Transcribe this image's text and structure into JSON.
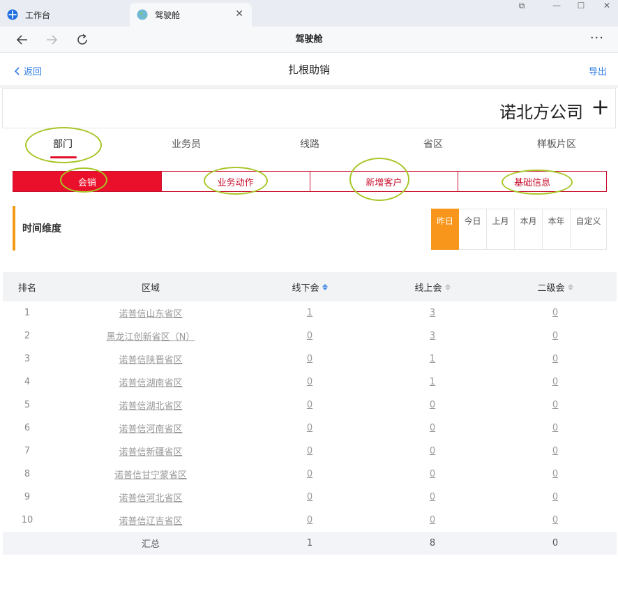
{
  "window": {
    "tabs": [
      {
        "label": "工作台",
        "icon": "app-grid-icon"
      },
      {
        "label": "驾驶舱",
        "icon": "globe-icon"
      }
    ],
    "nav_title": "驾驶舱"
  },
  "header": {
    "back_label": "返回",
    "title": "扎根助销",
    "export_label": "导出"
  },
  "company": {
    "name": "诺北方公司",
    "add_symbol": "+"
  },
  "dimension_tabs": [
    "部门",
    "业务员",
    "线路",
    "省区",
    "样板片区"
  ],
  "segments": [
    "会销",
    "业务动作",
    "新增客户",
    "基础信息"
  ],
  "time": {
    "label": "时间维度",
    "options": [
      "昨日",
      "今日",
      "上月",
      "本月",
      "本年",
      "自定义"
    ],
    "selected": "昨日"
  },
  "table": {
    "headers": {
      "rank": "排名",
      "area": "区域",
      "offline": "线下会",
      "online": "线上会",
      "second": "二级会"
    },
    "rows": [
      {
        "rank": "1",
        "area": "诺普信山东省区",
        "offline": "1",
        "online": "3",
        "second": "0"
      },
      {
        "rank": "2",
        "area": "黑龙江创新省区（N）",
        "offline": "0",
        "online": "3",
        "second": "0"
      },
      {
        "rank": "3",
        "area": "诺普信陕晋省区",
        "offline": "0",
        "online": "1",
        "second": "0"
      },
      {
        "rank": "4",
        "area": "诺普信湖南省区",
        "offline": "0",
        "online": "1",
        "second": "0"
      },
      {
        "rank": "5",
        "area": "诺普信湖北省区",
        "offline": "0",
        "online": "0",
        "second": "0"
      },
      {
        "rank": "6",
        "area": "诺普信河南省区",
        "offline": "0",
        "online": "0",
        "second": "0"
      },
      {
        "rank": "7",
        "area": "诺普信新疆省区",
        "offline": "0",
        "online": "0",
        "second": "0"
      },
      {
        "rank": "8",
        "area": "诺普信甘宁蒙省区",
        "offline": "0",
        "online": "0",
        "second": "0"
      },
      {
        "rank": "9",
        "area": "诺普信河北省区",
        "offline": "0",
        "online": "0",
        "second": "0"
      },
      {
        "rank": "10",
        "area": "诺普信辽吉省区",
        "offline": "0",
        "online": "0",
        "second": "0"
      }
    ],
    "total": {
      "label": "汇总",
      "offline": "1",
      "online": "8",
      "second": "0"
    }
  },
  "colors": {
    "accent_red": "#ea0f2b",
    "accent_orange": "#f8961b",
    "link_blue": "#2d7be5",
    "annotation_green": "#a7c627"
  }
}
